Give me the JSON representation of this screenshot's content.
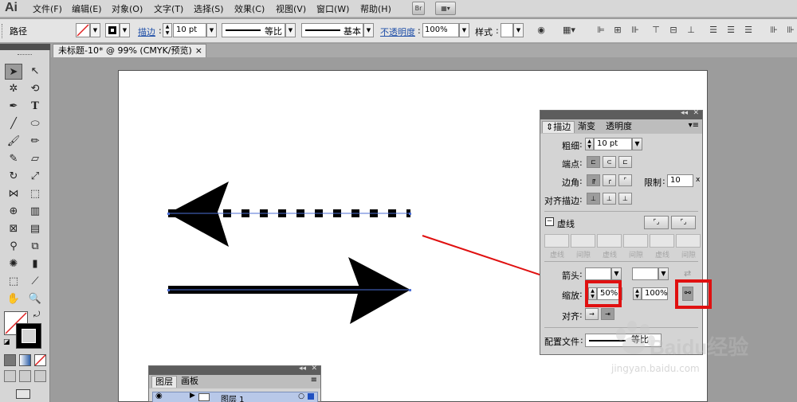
{
  "app": {
    "logo": "Ai"
  },
  "menu": {
    "items": [
      "文件(F)",
      "编辑(E)",
      "对象(O)",
      "文字(T)",
      "选择(S)",
      "效果(C)",
      "视图(V)",
      "窗口(W)",
      "帮助(H)"
    ],
    "bridge_button": "Br",
    "workspace_button": "▦▾"
  },
  "control": {
    "selection_type": "路径",
    "stroke_label": "描边",
    "stroke_weight": "10 pt",
    "profile_value": "等比",
    "brush_value": "基本",
    "opacity_label": "不透明度",
    "opacity_value": "100%",
    "style_label": "样式"
  },
  "document": {
    "tab_title": "未标题-10* @ 99% (CMYK/预览)",
    "close": "×"
  },
  "stroke_panel": {
    "tabs": [
      "描边",
      "渐变",
      "透明度"
    ],
    "weight_label": "粗细",
    "weight_value": "10 pt",
    "cap_label": "端点",
    "corner_label": "边角",
    "limit_label": "限制",
    "limit_value": "10",
    "limit_unit": "x",
    "align_label": "对齐描边",
    "dashed_label": "虚线",
    "dash_labels": [
      "虚线",
      "间隙",
      "虚线",
      "间隙",
      "虚线",
      "间隙"
    ],
    "arrowhead_label": "箭头",
    "scale_label": "缩放",
    "scale_start": "50%",
    "scale_end": "100%",
    "arrow_align_label": "对齐",
    "profile_label": "配置文件",
    "profile_value": "等比"
  },
  "layers_panel": {
    "tabs": [
      "图层",
      "画板"
    ],
    "layer_name": "图层 1"
  },
  "watermark": {
    "brand": "Baidu经验",
    "url": "jingyan.baidu.com"
  }
}
